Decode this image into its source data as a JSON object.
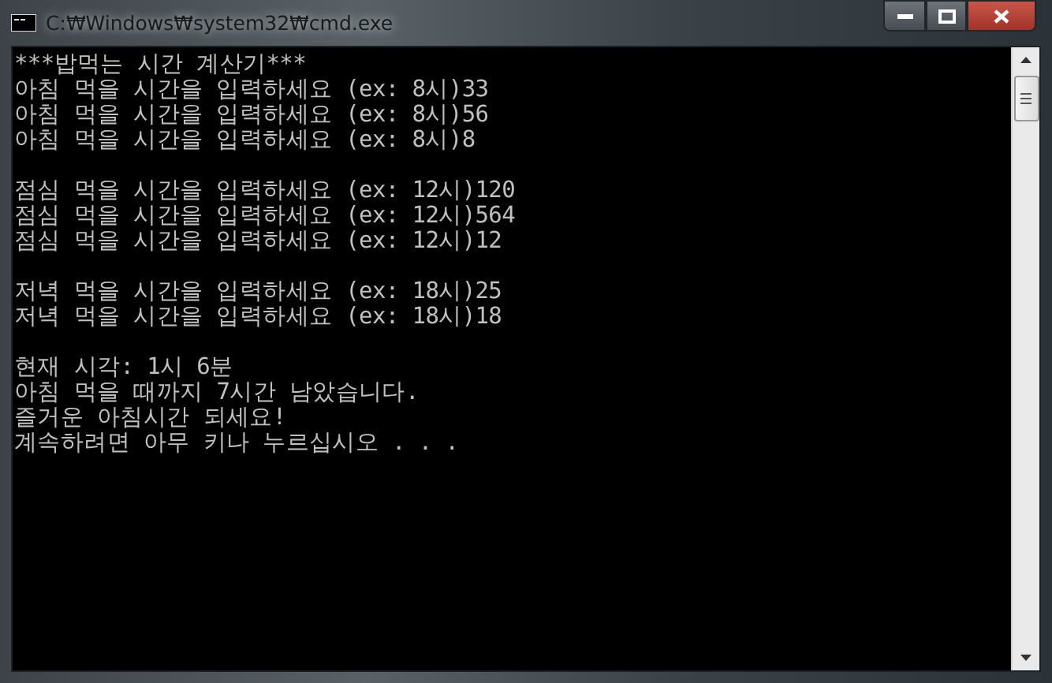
{
  "window": {
    "title": "C:₩Windows₩system32₩cmd.exe"
  },
  "console": {
    "blocks": [
      [
        "***밥먹는 시간 계산기***",
        "아침 먹을 시간을 입력하세요 (ex: 8시)33",
        "아침 먹을 시간을 입력하세요 (ex: 8시)56",
        "아침 먹을 시간을 입력하세요 (ex: 8시)8"
      ],
      [
        "점심 먹을 시간을 입력하세요 (ex: 12시)120",
        "점심 먹을 시간을 입력하세요 (ex: 12시)564",
        "점심 먹을 시간을 입력하세요 (ex: 12시)12"
      ],
      [
        "저녁 먹을 시간을 입력하세요 (ex: 18시)25",
        "저녁 먹을 시간을 입력하세요 (ex: 18시)18"
      ],
      [
        "현재 시각: 1시 6분",
        "아침 먹을 때까지 7시간 남았습니다.",
        "즐거운 아침시간 되세요!",
        "계속하려면 아무 키나 누르십시오 . . ."
      ]
    ]
  }
}
